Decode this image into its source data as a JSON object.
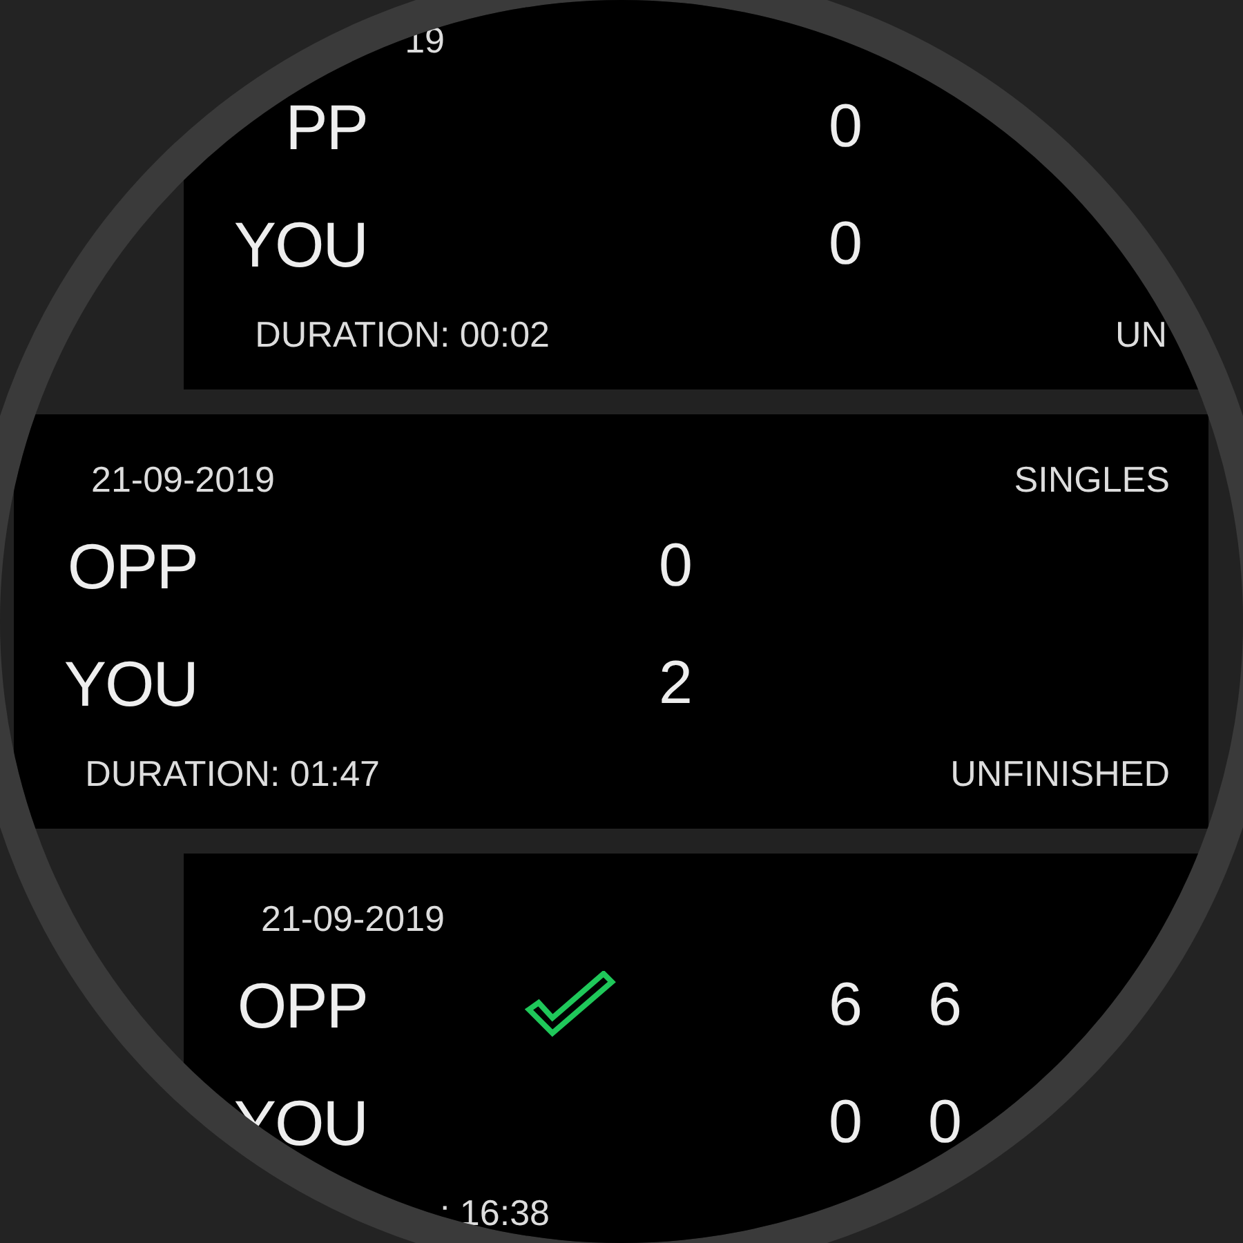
{
  "matches": [
    {
      "selected": false,
      "date": "19",
      "players": [
        {
          "name": "PP",
          "winner": false,
          "scores": [
            "0"
          ]
        },
        {
          "name": "YOU",
          "winner": false,
          "scores": [
            "0"
          ]
        }
      ],
      "duration": "DURATION: 00:02",
      "status": "UN"
    },
    {
      "selected": true,
      "date": "21-09-2019",
      "type": "SINGLES",
      "players": [
        {
          "name": "OPP",
          "winner": false,
          "scores": [
            "0"
          ]
        },
        {
          "name": "YOU",
          "winner": false,
          "scores": [
            "2"
          ]
        }
      ],
      "duration": "DURATION: 01:47",
      "status": "UNFINISHED"
    },
    {
      "selected": false,
      "date": "21-09-2019",
      "players": [
        {
          "name": "OPP",
          "winner": true,
          "scores": [
            "6",
            "6"
          ]
        },
        {
          "name": "YOU",
          "winner": false,
          "scores": [
            "0",
            "0"
          ]
        }
      ],
      "duration": ": 16:38"
    }
  ]
}
